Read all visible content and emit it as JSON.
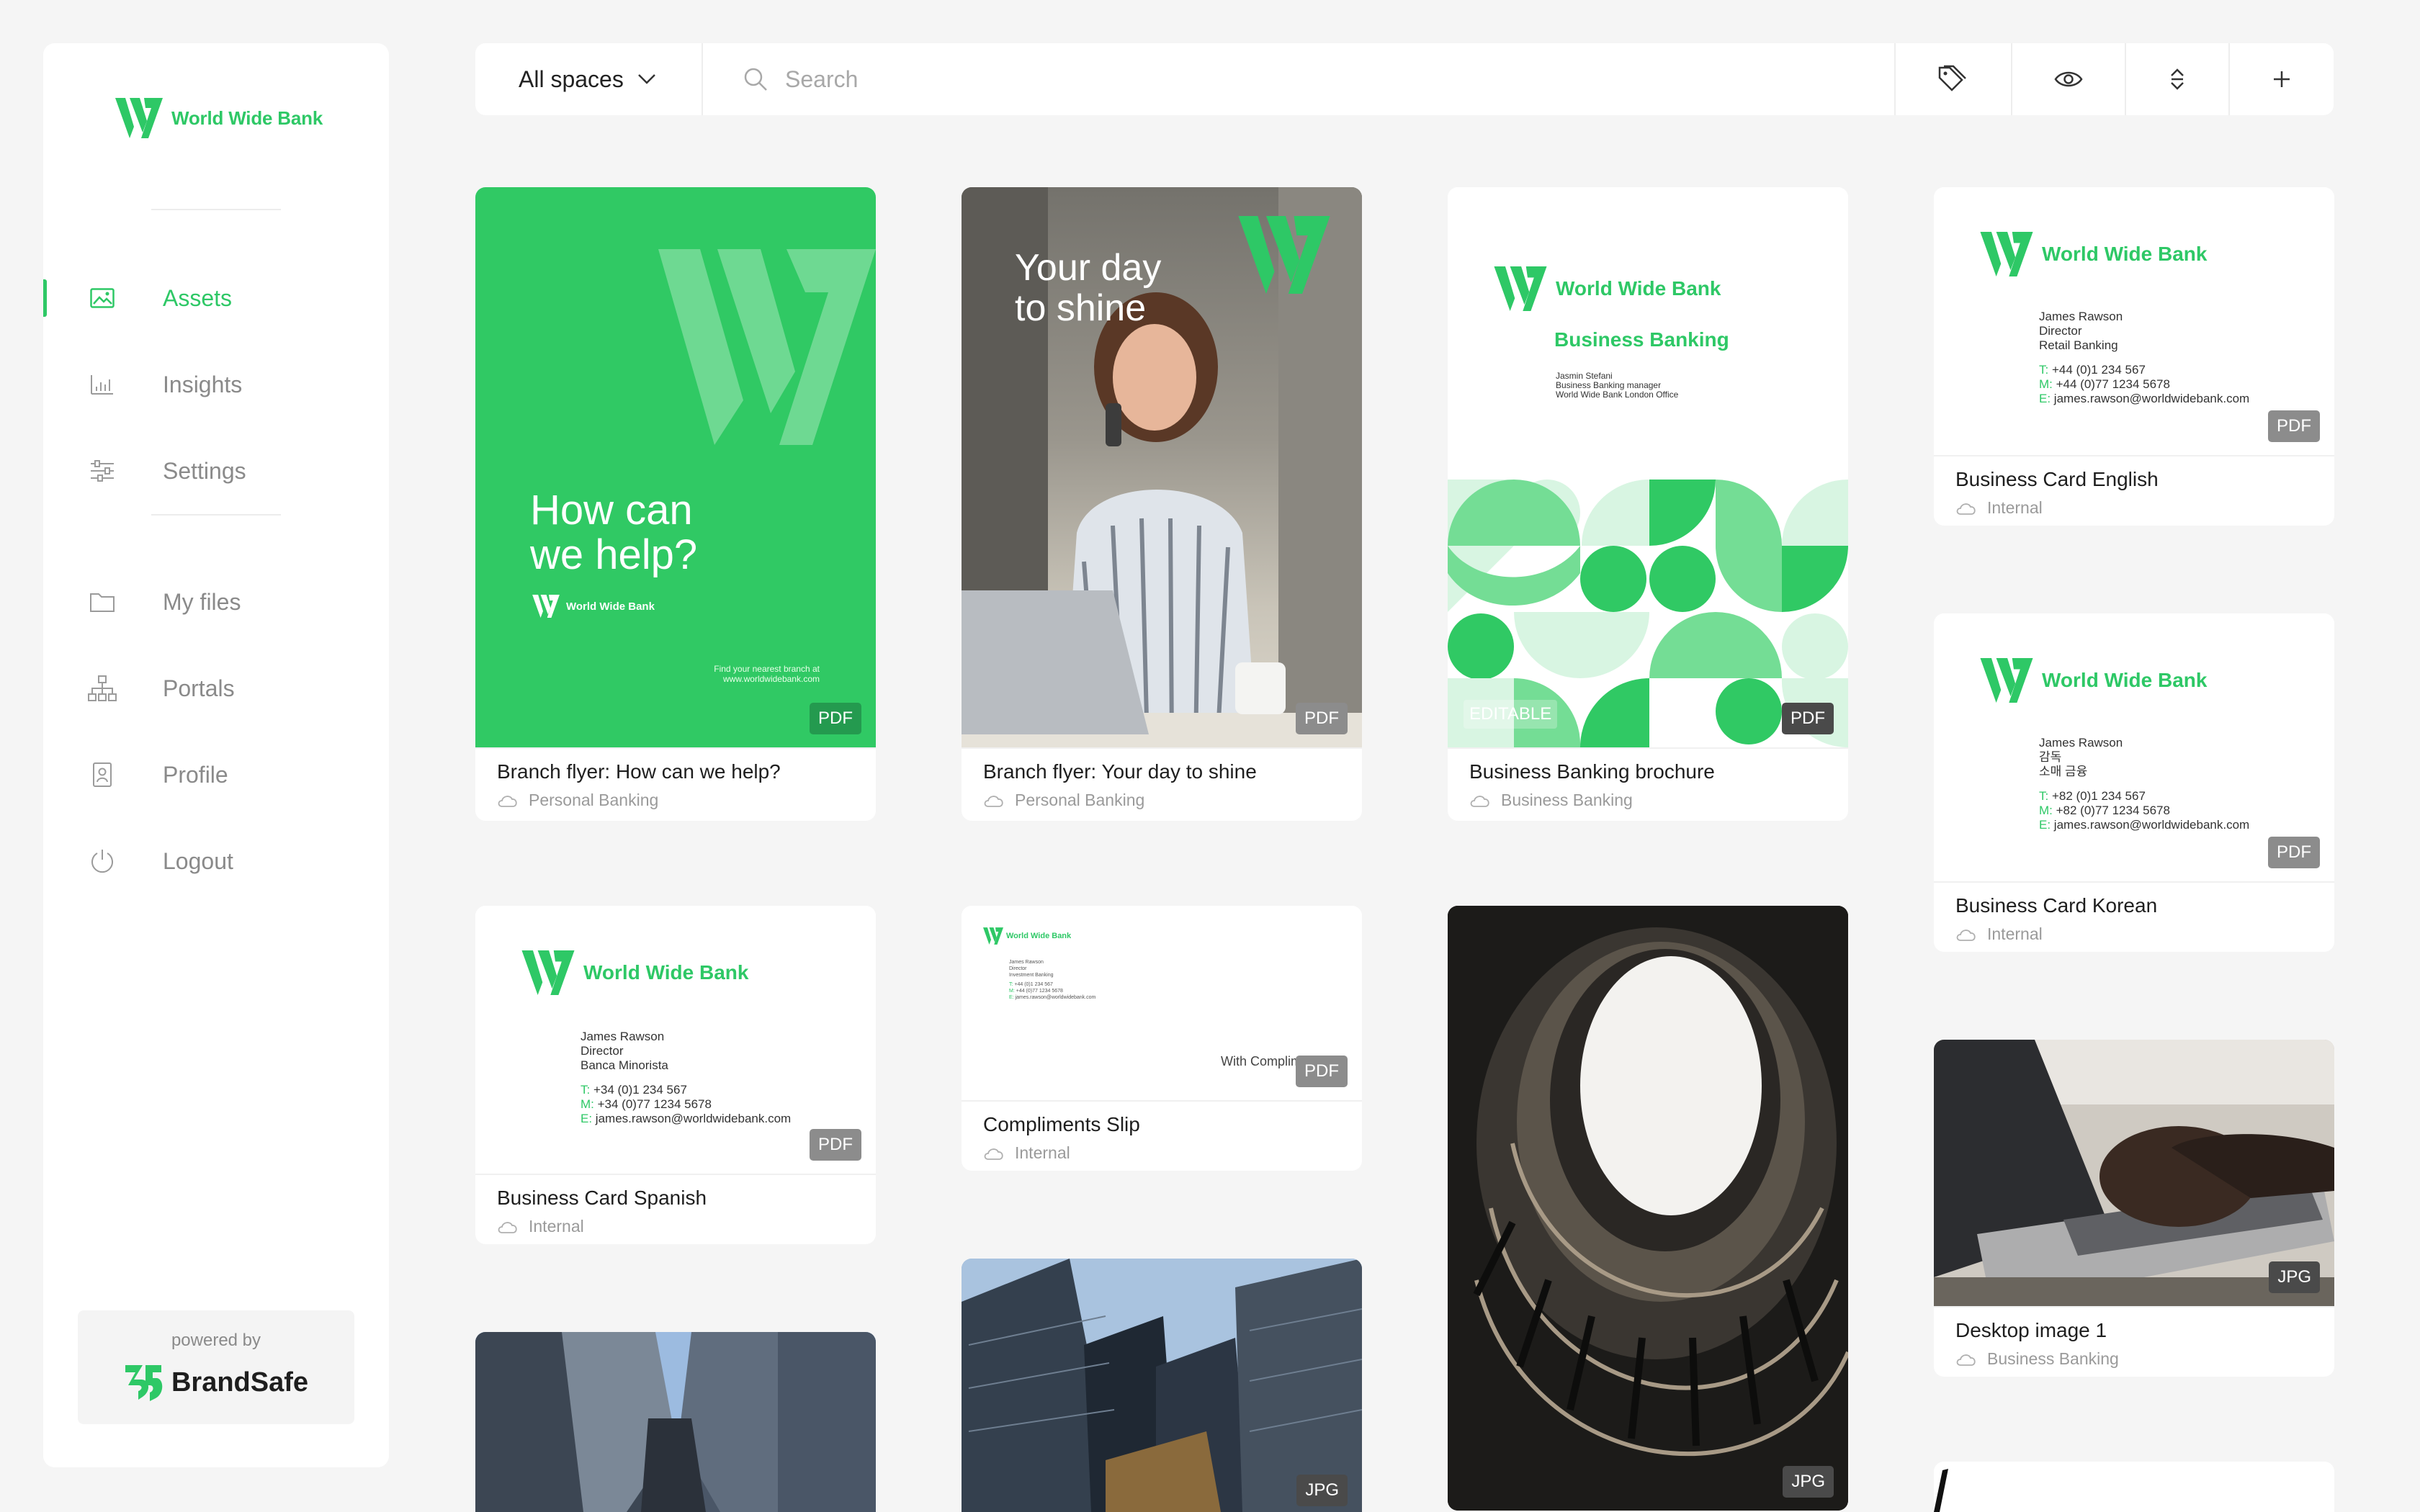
{
  "brand": {
    "name": "World Wide Bank",
    "accent": "#2ec866"
  },
  "nav": {
    "assets": {
      "label": "Assets",
      "icon": "image-icon"
    },
    "insights": {
      "label": "Insights",
      "icon": "bar-chart-icon"
    },
    "settings": {
      "label": "Settings",
      "icon": "sliders-icon"
    },
    "myfiles": {
      "label": "My files",
      "icon": "folder-icon"
    },
    "portals": {
      "label": "Portals",
      "icon": "sitemap-icon"
    },
    "profile": {
      "label": "Profile",
      "icon": "id-badge-icon"
    },
    "logout": {
      "label": "Logout",
      "icon": "power-icon"
    }
  },
  "powered": {
    "label": "powered by",
    "name": "BrandSafe"
  },
  "toolbar": {
    "spaces_label": "All spaces",
    "search_placeholder": "Search",
    "buttons": [
      "tag-icon",
      "eye-icon",
      "sort-icon",
      "plus-icon"
    ]
  },
  "cards": {
    "c1": {
      "title": "Branch flyer: How can we help?",
      "space": "Personal Banking",
      "type": "PDF",
      "headline_1": "How can",
      "headline_2": "we help?",
      "footer_1": "Find your nearest branch at",
      "footer_2": "www.worldwidebank.com"
    },
    "c2": {
      "title": "Branch flyer: Your day to shine",
      "space": "Personal Banking",
      "type": "PDF",
      "headline_1": "Your day",
      "headline_2": "to shine"
    },
    "c3": {
      "title": "Business Banking brochure",
      "space": "Business Banking",
      "type": "PDF",
      "flag": "EDITABLE",
      "heading": "Business Banking",
      "name": "Jasmin Stefani",
      "role": "Business Banking manager",
      "office": "World Wide Bank London Office"
    },
    "c4": {
      "title": "Business Card English",
      "space": "Internal",
      "type": "PDF",
      "name": "James Rawson",
      "role": "Director",
      "dept": "Retail Banking",
      "t": "+44 (0)1 234 567",
      "m": "+44 (0)77 1234 5678",
      "e": "james.rawson@worldwidebank.com"
    },
    "c5": {
      "title": "Business Card Korean",
      "space": "Internal",
      "type": "PDF",
      "name": "James Rawson",
      "role": "감독",
      "dept": "소매 금융",
      "t": "+82 (0)1 234 567",
      "m": "+82 (0)77 1234 5678",
      "e": "james.rawson@worldwidebank.com"
    },
    "c6": {
      "title": "Business Card Spanish",
      "space": "Internal",
      "type": "PDF",
      "name": "James Rawson",
      "role": "Director",
      "dept": "Banca Minorista",
      "t": "+34 (0)1 234 567",
      "m": "+34 (0)77 1234 5678",
      "e": "james.rawson@worldwidebank.com"
    },
    "c7": {
      "title": "Compliments Slip",
      "space": "Internal",
      "type": "PDF",
      "slip_text": "With Compliments",
      "name": "James Rawson",
      "role": "Director",
      "dept": "Investment Banking",
      "t": "+44 (0)1 234 567",
      "m": "+44 (0)77 1234 5678",
      "e": "james.rawson@worldwidebank.com"
    },
    "c8": {
      "type": "JPG"
    },
    "c9": {
      "title": "Desktop image 1",
      "space": "Business Banking",
      "type": "JPG"
    },
    "c10": {
      "type": "JPG"
    },
    "c11": {
      "type": "JPG"
    }
  }
}
